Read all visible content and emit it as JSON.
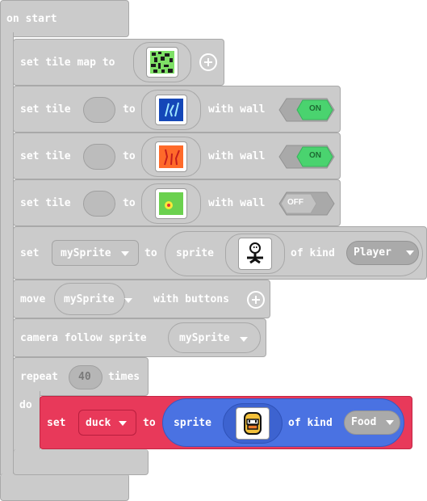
{
  "on_start": {
    "label": "on start"
  },
  "set_tilemap": {
    "label": "set tile map to"
  },
  "tile_rows": [
    {
      "set_label": "set tile",
      "to_label": "to",
      "wall_label": "with wall",
      "wall_state": "ON"
    },
    {
      "set_label": "set tile",
      "to_label": "to",
      "wall_label": "with wall",
      "wall_state": "ON"
    },
    {
      "set_label": "set tile",
      "to_label": "to",
      "wall_label": "with wall",
      "wall_state": "OFF"
    }
  ],
  "set_sprite": {
    "set_label": "set",
    "variable": "mySprite",
    "to_label": "to",
    "sprite_label": "sprite",
    "kind_label": "of kind",
    "kind": "Player"
  },
  "move": {
    "label": "move",
    "variable": "mySprite",
    "suffix": "with buttons"
  },
  "camera": {
    "label": "camera follow sprite",
    "variable": "mySprite"
  },
  "repeat": {
    "label": "repeat",
    "count": "40",
    "times_label": "times",
    "do_label": "do"
  },
  "set_duck": {
    "set_label": "set",
    "variable": "duck",
    "to_label": "to",
    "sprite_label": "sprite",
    "kind_label": "of kind",
    "kind": "Food"
  },
  "colors": {
    "block_gray": "#cbcbcb",
    "toggle_on": "#4ad36f",
    "loop_red": "#e8395a",
    "sprite_blue": "#4a72e2"
  }
}
